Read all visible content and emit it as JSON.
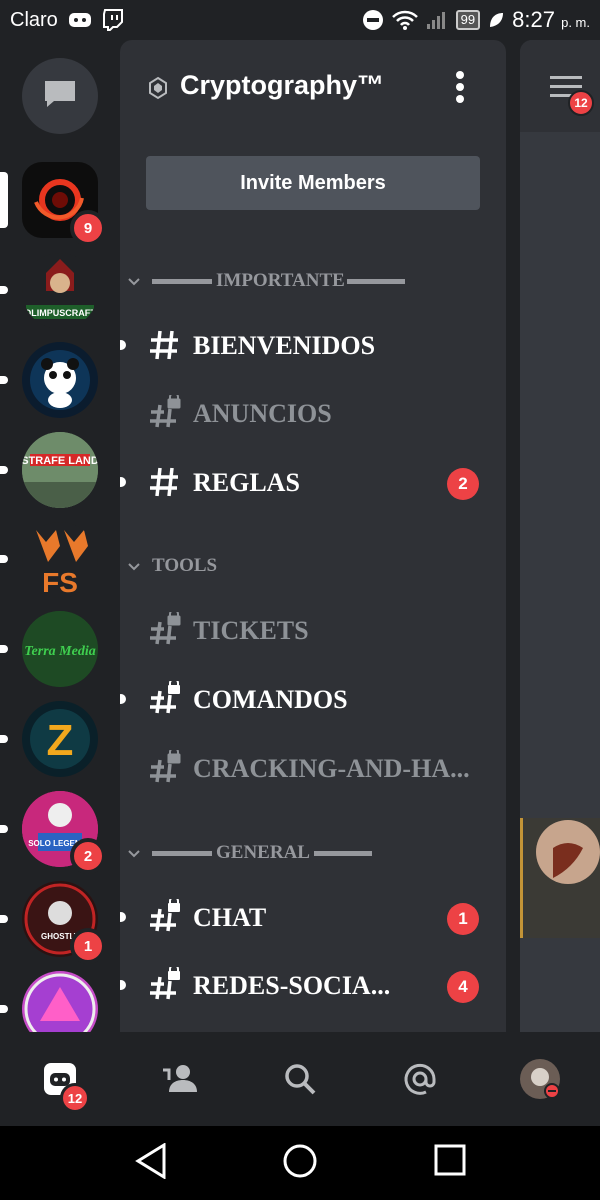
{
  "status_bar": {
    "carrier": "Claro",
    "battery": "99",
    "time": "8:27",
    "ampm": "p. m."
  },
  "guild": {
    "name": "Cryptography™",
    "invite_label": "Invite Members"
  },
  "servers": [
    {
      "name": "orbit-server",
      "badge": "9"
    },
    {
      "name": "olimpuscraft",
      "logo_text": "OLIMPUSCRAFT"
    },
    {
      "name": "panda-server"
    },
    {
      "name": "strafe-land",
      "logo_text": "STRAFE LAND"
    },
    {
      "name": "fs-server",
      "logo_text": "FS"
    },
    {
      "name": "terra-media",
      "logo_text": "Terra Media"
    },
    {
      "name": "z-server",
      "logo_text": "Z"
    },
    {
      "name": "solo-legends",
      "badge": "2",
      "logo_text": "SOLO LEGENDS"
    },
    {
      "name": "ghostly-server",
      "badge": "1",
      "logo_text": "GHOSTLY"
    },
    {
      "name": "purple-server"
    }
  ],
  "categories": [
    {
      "label": "IMPORTANTE"
    },
    {
      "label": "TOOLS"
    },
    {
      "label": "GENERAL"
    }
  ],
  "channels": [
    {
      "name": "BIENVENIDOS",
      "locked": false,
      "unread": true,
      "muted": false,
      "badge": ""
    },
    {
      "name": "ANUNCIOS",
      "locked": true,
      "unread": false,
      "muted": true,
      "badge": ""
    },
    {
      "name": "REGLAS",
      "locked": false,
      "unread": true,
      "muted": false,
      "badge": "2"
    },
    {
      "name": "TICKETS",
      "locked": true,
      "unread": false,
      "muted": true,
      "badge": ""
    },
    {
      "name": "COMANDOS",
      "locked": true,
      "unread": true,
      "muted": false,
      "badge": ""
    },
    {
      "name": "CRACKING-AND-HA...",
      "locked": true,
      "unread": false,
      "muted": true,
      "badge": ""
    },
    {
      "name": "CHAT",
      "locked": true,
      "unread": true,
      "muted": false,
      "badge": "1"
    },
    {
      "name": "REDES-SOCIA...",
      "locked": true,
      "unread": true,
      "muted": false,
      "badge": "4"
    }
  ],
  "peek": {
    "members_badge": "12"
  },
  "bottom_nav": {
    "home_badge": "12"
  },
  "colors": {
    "accent_red": "#ed4245",
    "panel": "#2f3136",
    "rail": "#202225"
  }
}
